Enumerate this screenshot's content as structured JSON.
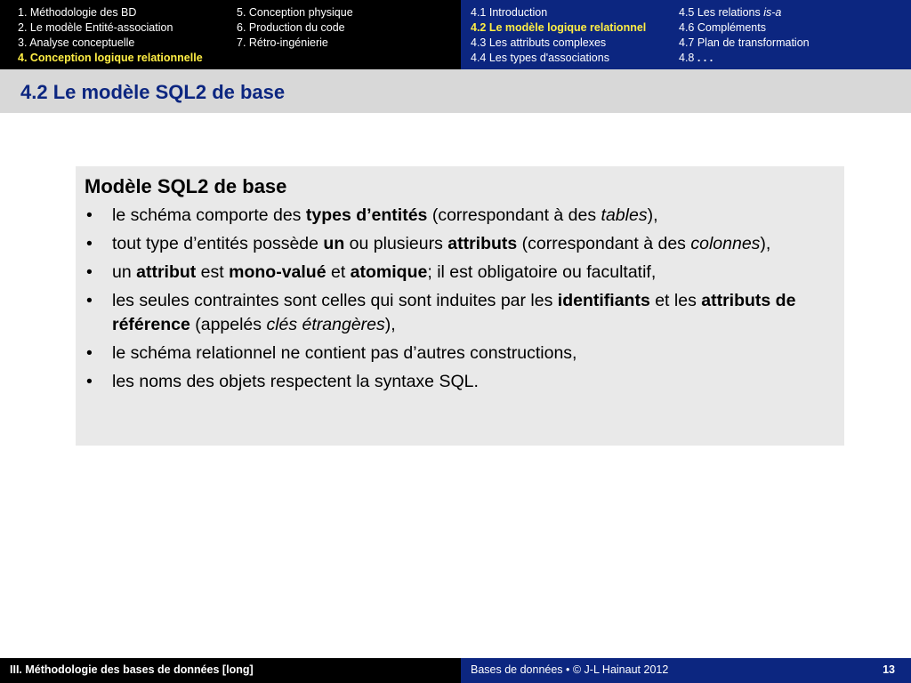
{
  "header": {
    "sections_left": [
      "1. Méthodologie des BD",
      "2. Le modèle Entité-association",
      "3. Analyse conceptuelle",
      "4. Conception logique relationnelle"
    ],
    "sections_right": [
      "5. Conception physique",
      "6. Production du code",
      "7. Rétro-ingénierie"
    ],
    "active_section": "4. Conception logique relationnelle",
    "subsections_left": [
      "4.1 Introduction",
      "4.2 Le modèle logique relationnel",
      "4.3 Les attributs complexes",
      "4.4 Les types d'associations"
    ],
    "subsections_right": {
      "item_0_prefix": "4.5 Les relations ",
      "item_0_emph": "is-a",
      "item_1": "4.6 Compléments",
      "item_2": "4.7 Plan de transformation",
      "item_3_prefix": "4.8 ",
      "item_3_emph": ". . ."
    },
    "active_subsection": "4.2 Le modèle logique relationnel"
  },
  "frame_title": "4.2 Le modèle SQL2 de base",
  "block": {
    "title": "Modèle SQL2 de base",
    "bullet_symbol": "•",
    "items": [
      {
        "t1": "le schéma comporte des ",
        "b1": "types d’entités",
        "t2": " (correspondant à des ",
        "i1": "tables",
        "t3": "),"
      },
      {
        "t1": "tout type d’entités possède ",
        "b1": "un",
        "t2": " ou plusieurs ",
        "b2": "attributs",
        "t3": " (correspondant à des ",
        "i1": "colonnes",
        "t4": "),"
      },
      {
        "t1": "un ",
        "b1": "attribut",
        "t2": " est ",
        "b2": "mono-valué",
        "t3": " et ",
        "b3": "atomique",
        "t4": "; il est obligatoire ou facultatif,"
      },
      {
        "t1": "les seules contraintes sont celles qui sont induites par les ",
        "b1": "identifiants",
        "t2": " et les ",
        "b2": "attributs de référence",
        "t3": " (appelés ",
        "i1": "clés étrangères",
        "t4": "),"
      },
      {
        "t1": "le schéma relationnel ne contient pas d’autres constructions,"
      },
      {
        "t1": "les noms des objets respectent la syntaxe SQL."
      }
    ]
  },
  "footer": {
    "left_title": "III. Méthodologie des bases de données [long]",
    "center_text": "Bases de données • © J-L Hainaut  2012",
    "page_number": "13"
  },
  "colors": {
    "nav_dark": "#000000",
    "nav_blue": "#0c2680",
    "active_highlight": "#ffee44",
    "title_bar": "#d8d8d8",
    "block_bg": "#e9e9e9"
  }
}
